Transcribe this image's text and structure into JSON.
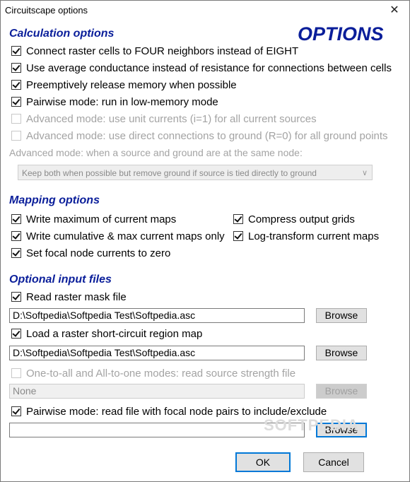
{
  "window": {
    "title": "Circuitscape options",
    "close_icon": "✕"
  },
  "banner": "OPTIONS",
  "calculation": {
    "heading": "Calculation options",
    "options": [
      {
        "label": "Connect raster cells to FOUR neighbors instead of EIGHT",
        "checked": true,
        "enabled": true
      },
      {
        "label": "Use average conductance instead of resistance for connections between cells",
        "checked": true,
        "enabled": true
      },
      {
        "label": "Preemptively release memory when possible",
        "checked": true,
        "enabled": true
      },
      {
        "label": "Pairwise mode: run in low-memory mode",
        "checked": true,
        "enabled": true
      },
      {
        "label": "Advanced mode: use unit currents (i=1) for all current sources",
        "checked": false,
        "enabled": false
      },
      {
        "label": "Advanced mode: use direct connections to ground (R=0) for all ground points",
        "checked": false,
        "enabled": false
      }
    ],
    "same_node_label": "Advanced mode: when a source and ground are at the same node:",
    "same_node_select": "Keep both when possible but remove ground if source is tied directly to ground"
  },
  "mapping": {
    "heading": "Mapping options",
    "options": [
      {
        "label": "Write maximum of current maps",
        "checked": true
      },
      {
        "label": "Compress output grids",
        "checked": true
      },
      {
        "label": "Write cumulative & max current maps only",
        "checked": true
      },
      {
        "label": "Log-transform current maps",
        "checked": true
      },
      {
        "label": "Set focal node currents to zero",
        "checked": true
      }
    ]
  },
  "inputs": {
    "heading": "Optional input files",
    "mask": {
      "label": "Read raster mask file",
      "checked": true,
      "path": "D:\\Softpedia\\Softpedia Test\\Softpedia.asc",
      "browse": "Browse"
    },
    "short_circuit": {
      "label": "Load a raster short-circuit region map",
      "checked": true,
      "path": "D:\\Softpedia\\Softpedia Test\\Softpedia.asc",
      "browse": "Browse"
    },
    "source_strength": {
      "label": "One-to-all and All-to-one modes: read source strength file",
      "checked": false,
      "path": "None",
      "browse": "Browse"
    },
    "focal_pairs": {
      "label": "Pairwise mode: read file with focal node pairs to include/exclude",
      "checked": true,
      "path": "",
      "browse": "Browse"
    }
  },
  "buttons": {
    "ok": "OK",
    "cancel": "Cancel"
  },
  "watermark": "SOFTPEDIA"
}
